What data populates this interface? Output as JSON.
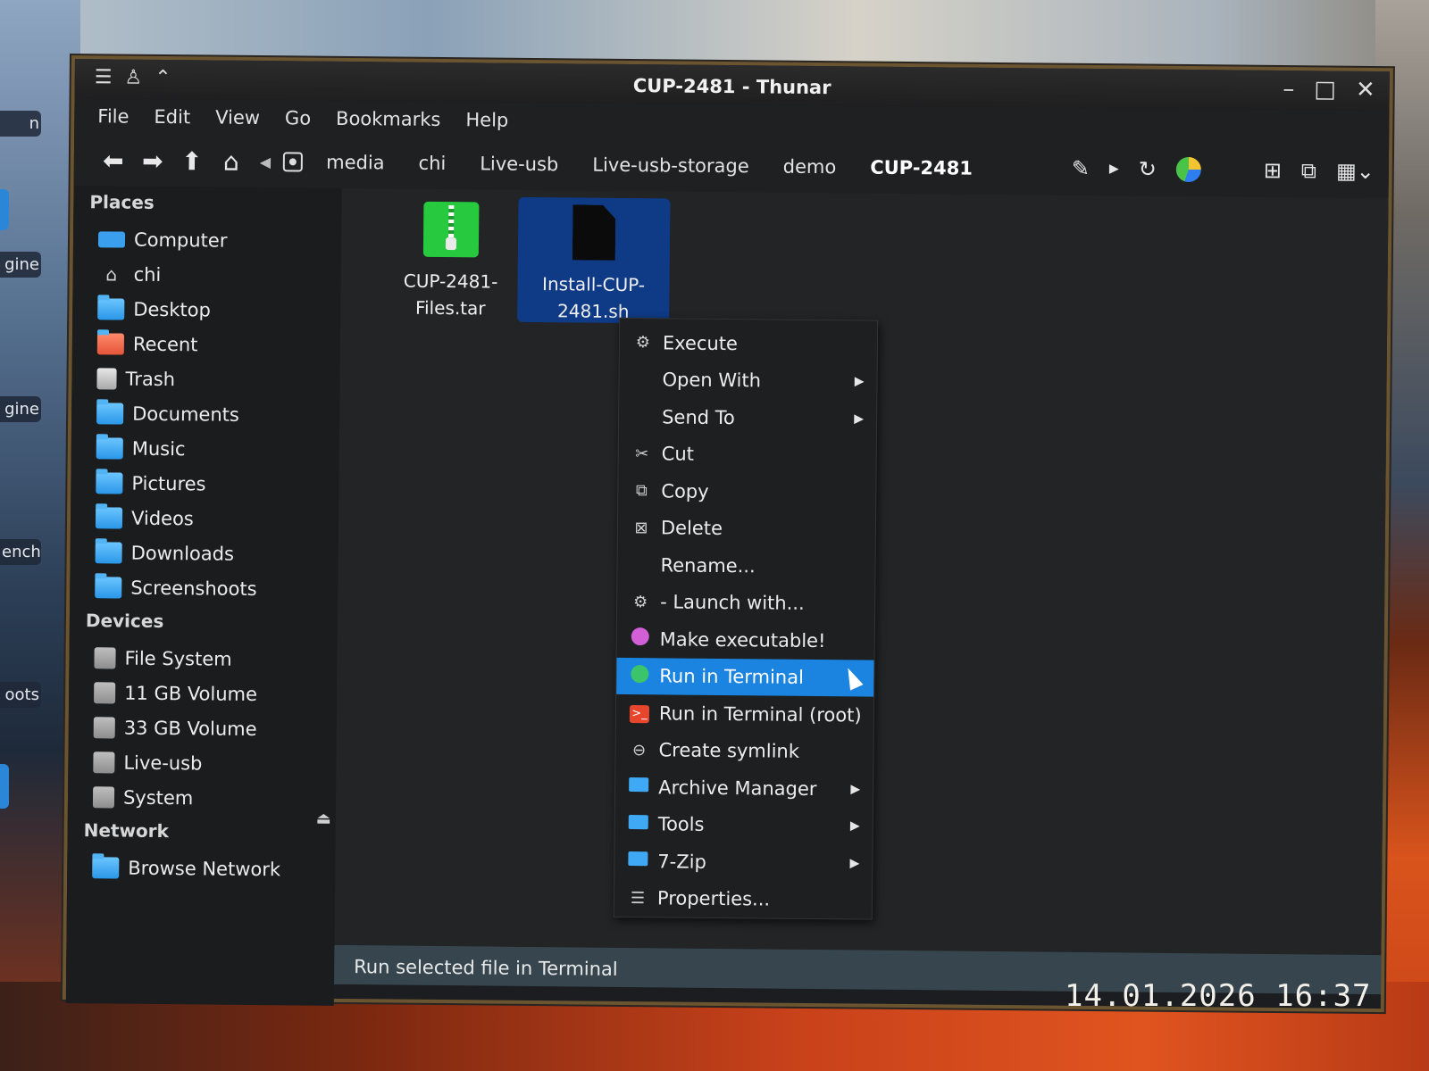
{
  "desktop": {
    "labels": [
      "n",
      "gine",
      "gine",
      "ench",
      "oots"
    ]
  },
  "window": {
    "title": "CUP-2481 - Thunar",
    "controls": {
      "minimize": "–",
      "maximize": "□",
      "close": "✕"
    }
  },
  "menubar": [
    "File",
    "Edit",
    "View",
    "Go",
    "Bookmarks",
    "Help"
  ],
  "toolbar": {
    "breadcrumbs": [
      "media",
      "chi",
      "Live-usb",
      "Live-usb-storage",
      "demo",
      "CUP-2481"
    ]
  },
  "sidebar": {
    "places_title": "Places",
    "places": [
      "Computer",
      "chi",
      "Desktop",
      "Recent",
      "Trash",
      "Documents",
      "Music",
      "Pictures",
      "Videos",
      "Downloads",
      "Screenshoots"
    ],
    "devices_title": "Devices",
    "devices": [
      "File System",
      "11 GB Volume",
      "33 GB Volume",
      "Live-usb",
      "System"
    ],
    "network_title": "Network",
    "network": [
      "Browse Network"
    ]
  },
  "files": [
    {
      "name": "CUP-2481-Files.tar",
      "icon": "archive-icon"
    },
    {
      "name": "Install-CUP-2481.sh",
      "icon": "script-icon",
      "selected": true
    }
  ],
  "context_menu": {
    "items": [
      "Execute",
      "Open With",
      "Send To",
      "Cut",
      "Copy",
      "Delete",
      "Rename...",
      "- Launch with...",
      "Make executable!",
      "Run in Terminal",
      "Run in Terminal (root)",
      "Create symlink",
      "Archive Manager",
      "Tools",
      "7-Zip",
      "Properties..."
    ],
    "highlighted": "Run in Terminal"
  },
  "statusbar": {
    "text": "Run selected file in Terminal"
  },
  "timestamp": "14.01.2026 16:37",
  "colors": {
    "accent": "#1a84e0",
    "window_border": "#6b5531",
    "statusbar": "#37454e"
  }
}
